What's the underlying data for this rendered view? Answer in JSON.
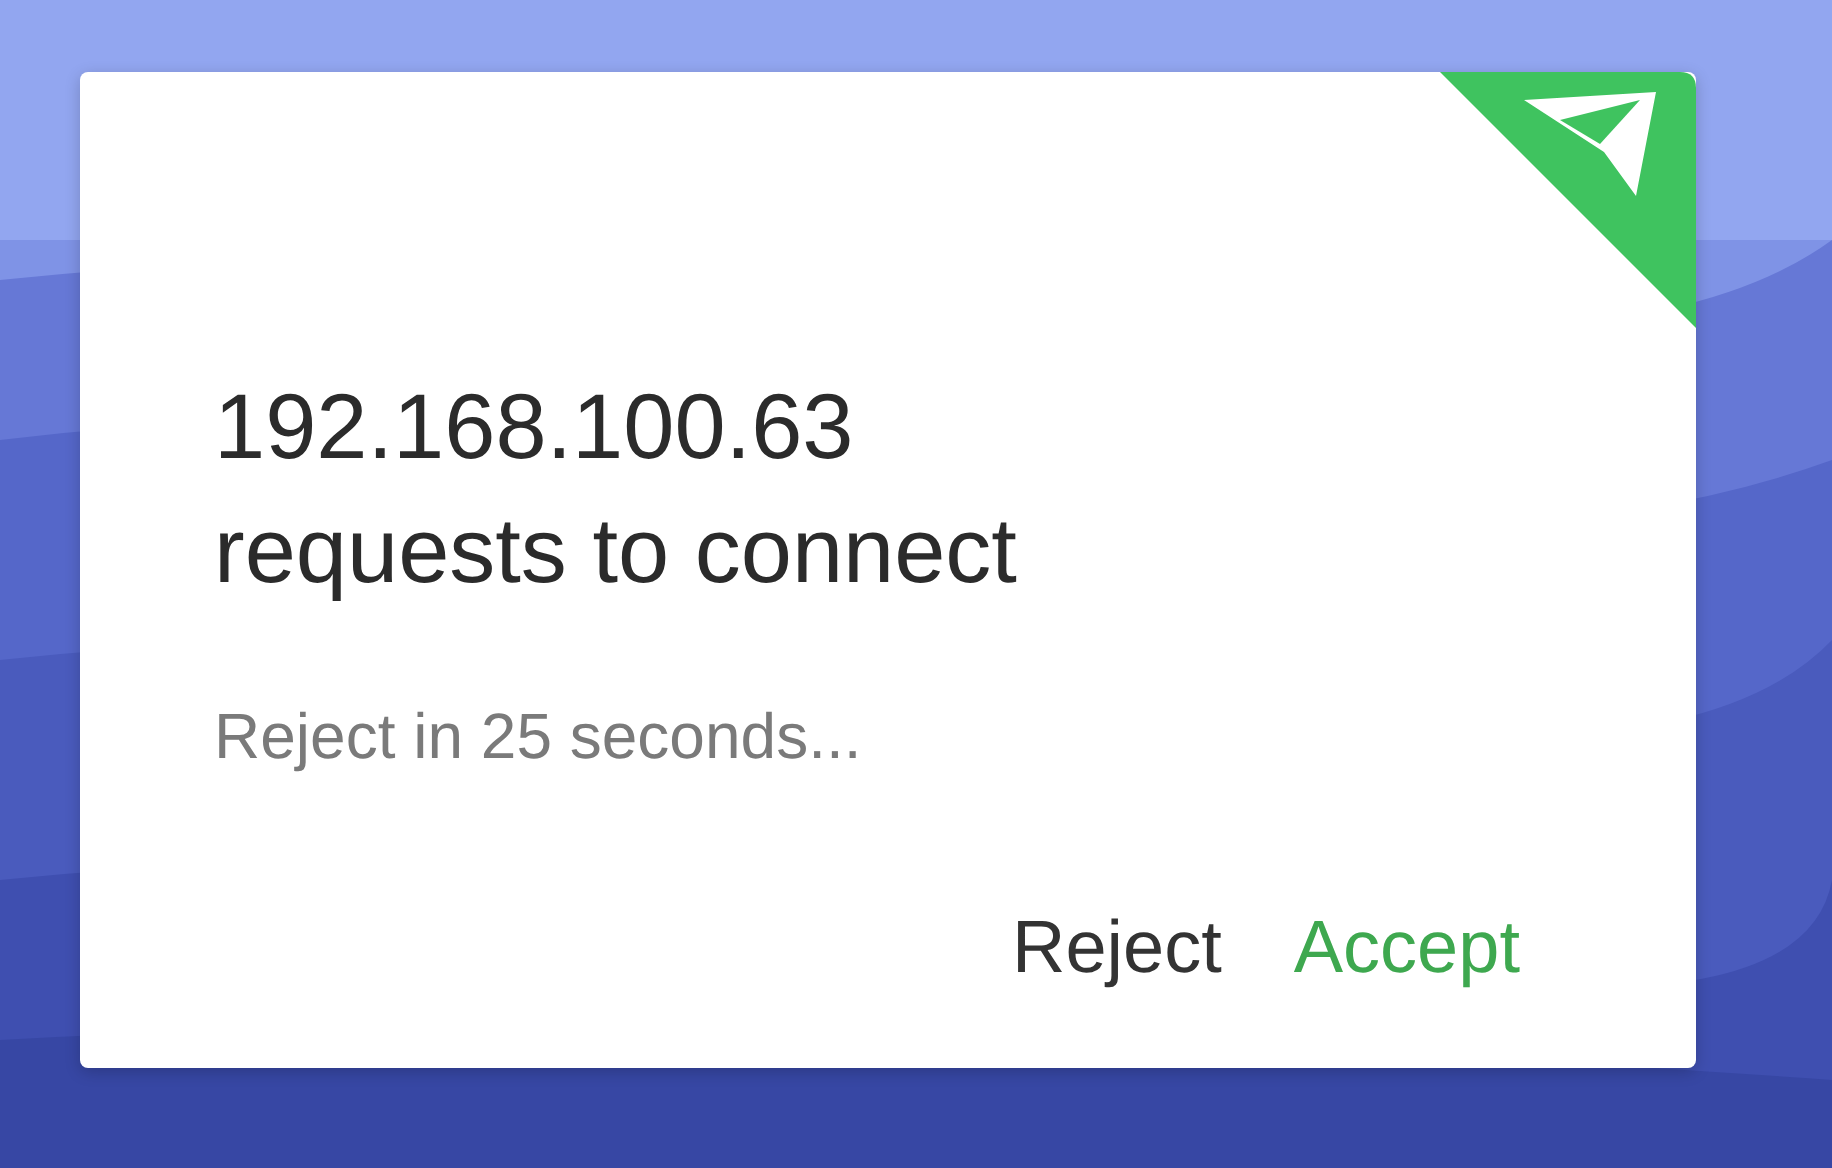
{
  "dialog": {
    "title_lines": [
      "192.168.100.63",
      "requests to connect"
    ],
    "countdown": "Reject in 25 seconds...",
    "buttons": [
      {
        "label": "Reject",
        "kind": "neutral"
      },
      {
        "label": "Accept",
        "kind": "primary"
      }
    ]
  }
}
